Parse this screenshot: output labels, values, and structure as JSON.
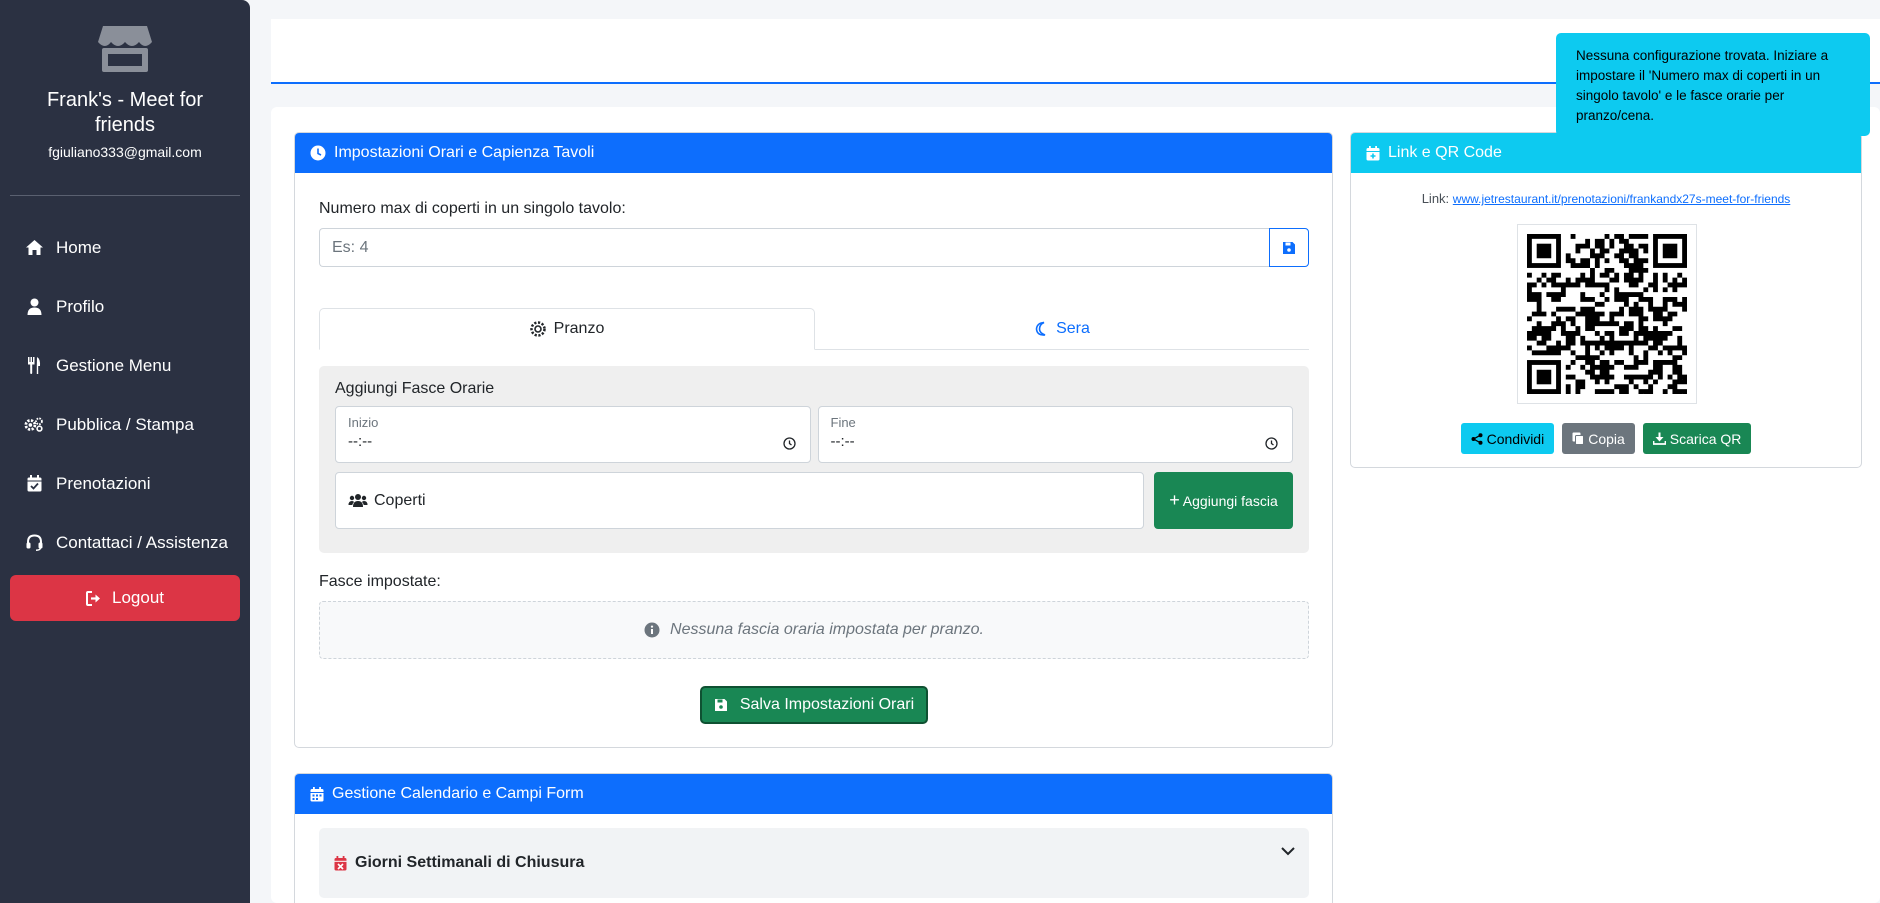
{
  "sidebar": {
    "restaurant_name": "Frank's - Meet for friends",
    "email": "fgiuliano333@gmail.com",
    "items": [
      {
        "label": "Home",
        "icon": "home-icon"
      },
      {
        "label": "Profilo",
        "icon": "user-icon"
      },
      {
        "label": "Gestione Menu",
        "icon": "utensils-icon"
      },
      {
        "label": "Pubblica / Stampa",
        "icon": "gears-icon"
      },
      {
        "label": "Prenotazioni",
        "icon": "calendar-check-icon"
      },
      {
        "label": "Contattaci / Assistenza",
        "icon": "headset-icon"
      }
    ],
    "logout_label": "Logout"
  },
  "settings_card": {
    "title": "Impostazioni Orari e Capienza Tavoli",
    "max_covers_label": "Numero max di coperti in un singolo tavolo:",
    "max_covers_placeholder": "Es: 4",
    "max_covers_value": "",
    "tabs": [
      {
        "label": "Pranzo",
        "active": true
      },
      {
        "label": "Sera",
        "active": false
      }
    ],
    "add_slots_title": "Aggiungi Fasce Orarie",
    "start_label": "Inizio",
    "start_value": "--:--",
    "end_label": "Fine",
    "end_value": "--:--",
    "covers_placeholder": "Coperti",
    "add_slot_button": "Aggiungi fascia",
    "slots_set_label": "Fasce impostate:",
    "no_slots_message": "Nessuna fascia oraria impostata per pranzo.",
    "save_button": "Salva Impostazioni Orari"
  },
  "calendar_card": {
    "title": "Gestione Calendario e Campi Form",
    "accordion_title": "Giorni Settimanali di Chiusura"
  },
  "qr_card": {
    "title": "Link e QR Code",
    "link_label": "Link:",
    "link_url": "www.jetrestaurant.it/prenotazioni/frankandx27s-meet-for-friends",
    "buttons": {
      "share": "Condividi",
      "copy": "Copia",
      "download": "Scarica QR"
    }
  },
  "toast": {
    "message": "Nessuna configurazione trovata. Iniziare a impostare il 'Numero max di coperti in un singolo tavolo' e le fasce orarie per pranzo/cena."
  },
  "colors": {
    "primary": "#0d6efd",
    "info": "#0dcaf0",
    "success": "#198754",
    "danger": "#dc3545",
    "sidebar": "#2b3142"
  }
}
